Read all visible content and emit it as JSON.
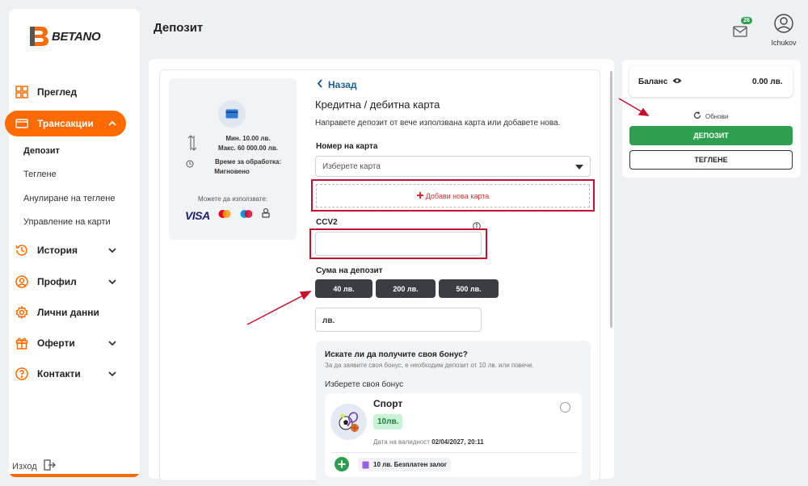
{
  "brand": {
    "name": "BETANO",
    "accent": "#ff6b00"
  },
  "sidebar": {
    "items": [
      {
        "label": "Преглед",
        "icon": "grid-icon"
      },
      {
        "label": "Трансакции",
        "icon": "card-icon"
      },
      {
        "label": "История",
        "icon": "history-icon"
      },
      {
        "label": "Профил",
        "icon": "user-circle-icon"
      },
      {
        "label": "Лични данни",
        "icon": "gear-icon"
      },
      {
        "label": "Оферти",
        "icon": "gift-icon"
      },
      {
        "label": "Контакти",
        "icon": "help-icon"
      }
    ],
    "subitems": [
      "Депозит",
      "Теглене",
      "Анулиране на теглене",
      "Управление на карти"
    ],
    "logout": "Изход"
  },
  "header": {
    "title": "Депозит",
    "mail_count": "26",
    "username": "Ichukov"
  },
  "info": {
    "min": "Мин. 10.00 лв.",
    "max": "Макс. 60 000.00 лв.",
    "processing_label": "Време за обработка:",
    "processing_value": "Мигновено",
    "use_label": "Можете да използвате:",
    "visa": "VISA"
  },
  "form": {
    "back": "Назад",
    "method_title": "Кредитна / дебитна карта",
    "method_desc": "Направете депозит от вече използвана карта или добавете нова.",
    "card_label": "Номер на карта",
    "card_placeholder": "Изберете карта",
    "add_card": "Добави нова карта",
    "ccv_label": "CCV2",
    "amount_label": "Сума на депозит",
    "amounts": [
      "40 лв.",
      "200 лв.",
      "500 лв."
    ],
    "amount_placeholder": "лв."
  },
  "bonus": {
    "question": "Искате ли да получите своя бонус?",
    "note": "За да заявите своя бонус, е необходим депозит от 10 лв. или повече.",
    "choose": "Изберете своя бонус",
    "title": "Спорт",
    "amount": "10лв.",
    "valid_label": "Дата на валидност",
    "valid_date": "02/04/2027, 20:11",
    "free_bet": "10 лв. Безплатен залог"
  },
  "account": {
    "balance_label": "Баланс",
    "balance_value": "0.00 лв.",
    "refresh": "Обнови",
    "deposit": "ДЕПОЗИТ",
    "withdraw": "ТЕГЛЕНЕ"
  },
  "colors": {
    "green": "#2e9e4f",
    "dark_button": "#3a3e44",
    "highlight_red": "#c8102e",
    "link_blue": "#1f5f99"
  }
}
